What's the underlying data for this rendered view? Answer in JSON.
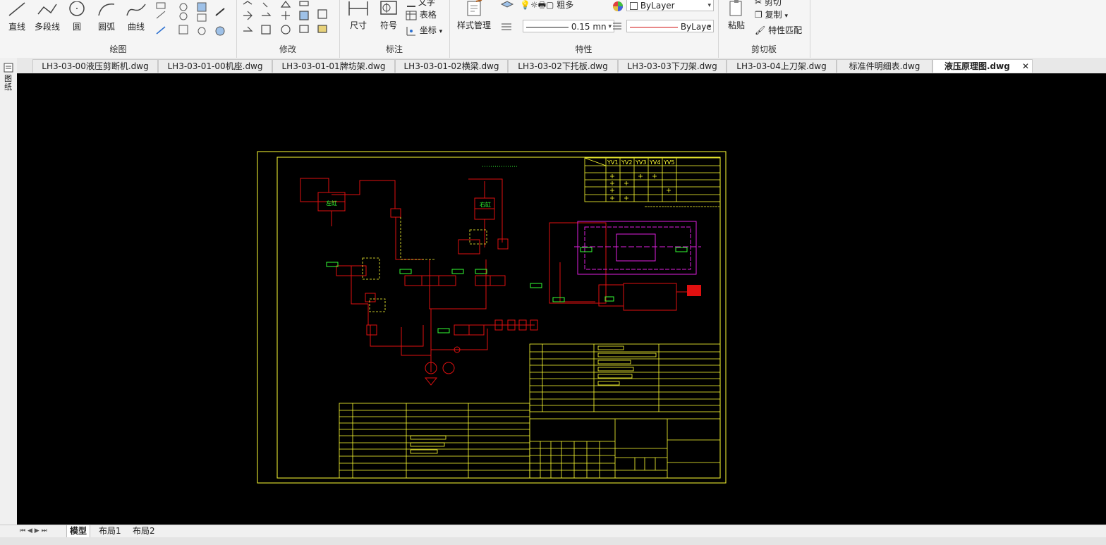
{
  "ribbon": {
    "draw": {
      "label": "绘图",
      "tools": [
        "直线",
        "多段线",
        "圆",
        "圆弧",
        "曲线"
      ]
    },
    "modify": {
      "label": "修改"
    },
    "annotate": {
      "label": "标注",
      "dimension": "尺寸",
      "symbol": "符号",
      "text": "文字",
      "table": "表格",
      "coordinate": "坐标"
    },
    "properties": {
      "label": "特性",
      "style_manager": "样式管理",
      "bold": "粗多",
      "layer_color": "ByLayer",
      "lineweight": "0.15 mn",
      "linetype": "ByLaye",
      "accent": "#d01010"
    },
    "clipboard": {
      "label": "剪切板",
      "paste": "粘贴",
      "cut": "剪切",
      "copy": "复制",
      "match": "特性匹配"
    }
  },
  "doc_tabs": [
    "LH3-03-00液压剪断机.dwg",
    "LH3-03-01-00机座.dwg",
    "LH3-03-01-01牌坊架.dwg",
    "LH3-03-01-02横梁.dwg",
    "LH3-03-02下托板.dwg",
    "LH3-03-03下刀架.dwg",
    "LH3-03-04上刀架.dwg",
    "标准件明细表.dwg",
    "液压原理图.dwg"
  ],
  "active_tab": "液压原理图.dwg",
  "close_glyph": "✕",
  "left_strip_label": "图纸",
  "layout_tabs": [
    "模型",
    "布局1",
    "布局2"
  ],
  "drawing": {
    "valve_table_header": [
      "YV1",
      "YV2",
      "YV3",
      "YV4",
      "YV5"
    ],
    "labels": {
      "cyl_left": "左缸",
      "cyl_right": "右缸"
    }
  },
  "colors": {
    "canvas_bg": "#000000",
    "frame": "#ffff33",
    "hydraulic": "#e01010",
    "pilot": "#ffff33",
    "component": "#33ff33",
    "machine": "#e020e0"
  }
}
